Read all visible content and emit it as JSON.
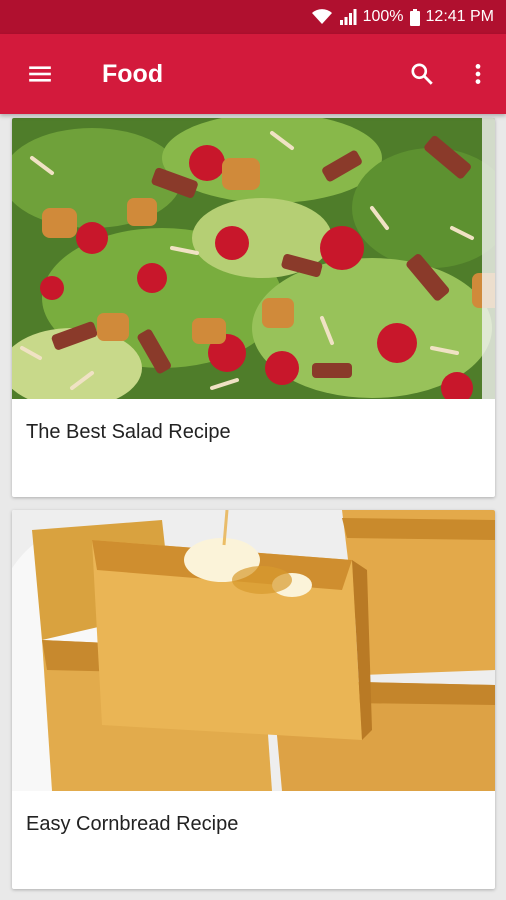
{
  "status": {
    "battery": "100%",
    "time": "12:41 PM",
    "icons": [
      "wifi-icon",
      "signal-icon",
      "battery-icon"
    ]
  },
  "appbar": {
    "title": "Food",
    "icons": [
      "menu-icon",
      "search-icon",
      "overflow-icon"
    ],
    "color": "#d31a3c",
    "status_color": "#b0102f"
  },
  "recipes": [
    {
      "title": "The Best Salad Recipe",
      "image": "salad-photo"
    },
    {
      "title": "Easy Cornbread Recipe",
      "image": "cornbread-photo"
    }
  ]
}
